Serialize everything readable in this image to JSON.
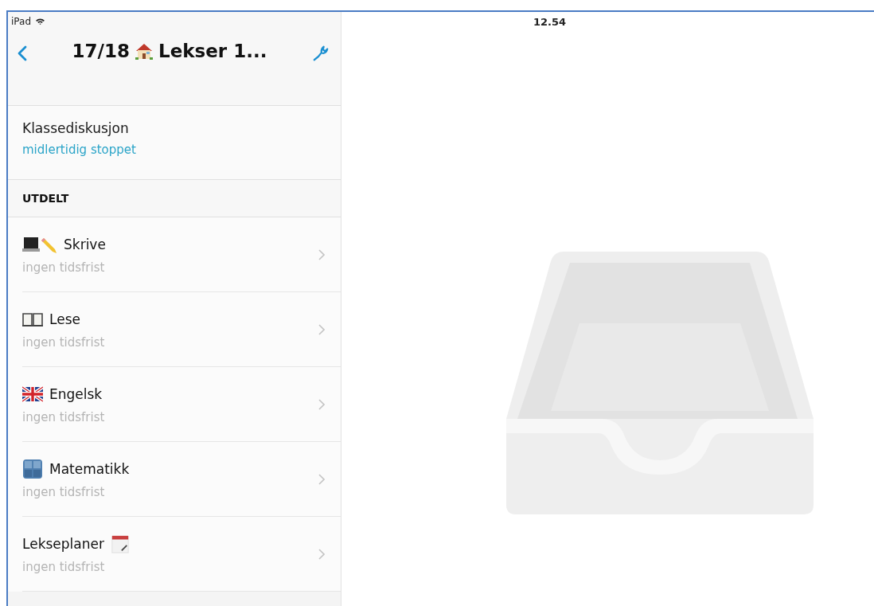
{
  "status_bar": {
    "device": "iPad",
    "time": "12.54"
  },
  "nav_bar": {
    "title_prefix": "17/18",
    "title_rest": "Lekser 1..."
  },
  "discussion": {
    "title": "Klassediskusjon",
    "status": "midlertidig stoppet"
  },
  "section": {
    "header": "UTDELT"
  },
  "items": [
    {
      "title": "Skrive",
      "subtitle": "ingen tidsfrist",
      "kind": "laptop-pencil"
    },
    {
      "title": "Lese",
      "subtitle": "ingen tidsfrist",
      "kind": "book"
    },
    {
      "title": "Engelsk",
      "subtitle": "ingen tidsfrist",
      "kind": "flag"
    },
    {
      "title": "Matematikk",
      "subtitle": "ingen tidsfrist",
      "kind": "numbers"
    },
    {
      "title": "Lekseplaner",
      "subtitle": "ingen tidsfrist",
      "kind": "calendar"
    }
  ]
}
